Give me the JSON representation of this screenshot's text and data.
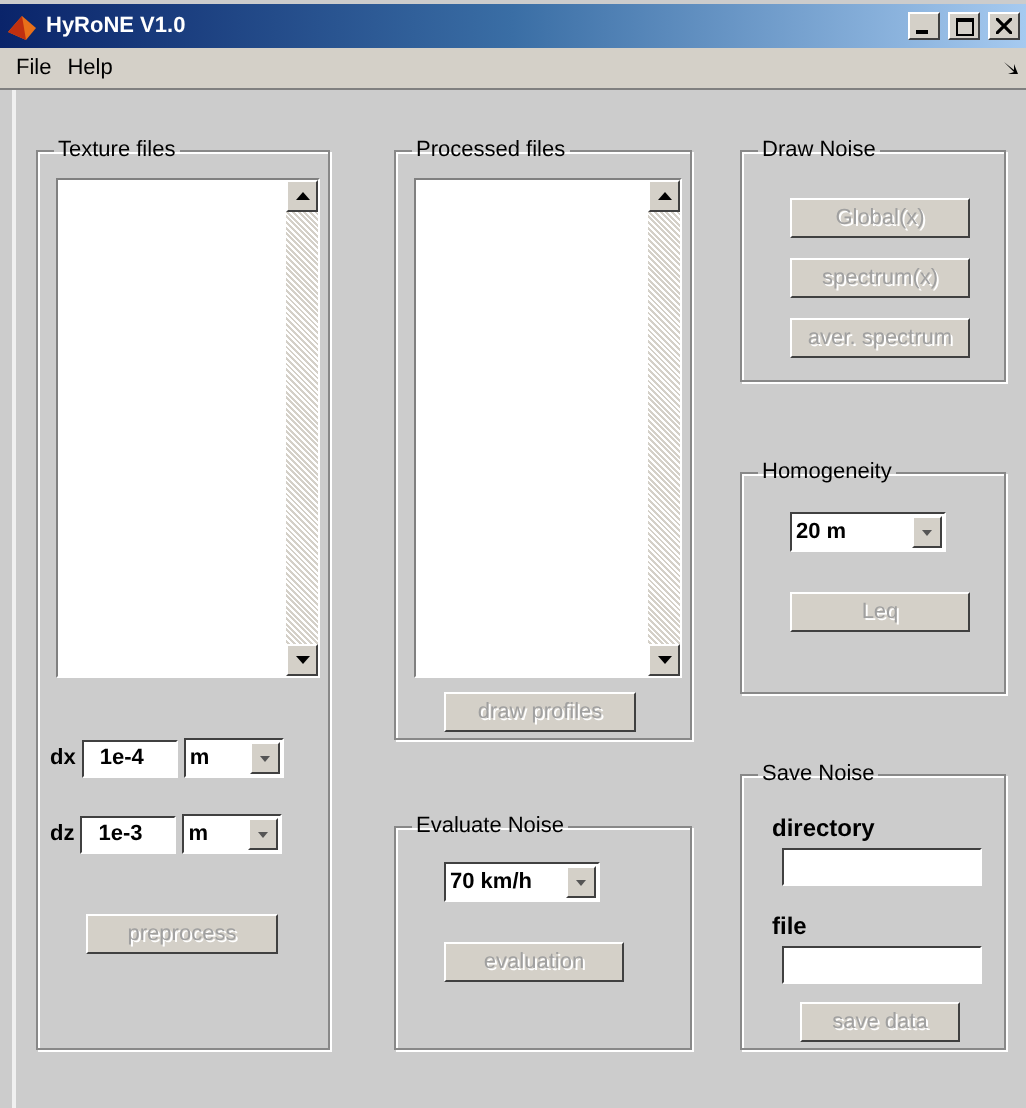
{
  "window": {
    "title": "HyRoNE V1.0"
  },
  "menu": [
    {
      "label": "File"
    },
    {
      "label": "Help"
    }
  ],
  "texture_files": {
    "title": "Texture files",
    "dx": {
      "label": "dx",
      "value": "1e-4",
      "unit": "m"
    },
    "dz": {
      "label": "dz",
      "value": "1e-3",
      "unit": "m"
    },
    "button": {
      "label": "preprocess",
      "disabled": true
    }
  },
  "processed_files": {
    "title": "Processed files",
    "button": {
      "label": "draw profiles",
      "disabled": true
    }
  },
  "evaluate_noise": {
    "title": "Evaluate Noise",
    "speed": "70 km/h",
    "button": {
      "label": "evaluation",
      "disabled": true
    }
  },
  "draw_noise": {
    "title": "Draw Noise",
    "buttons": [
      {
        "label": "Global(x)",
        "disabled": true
      },
      {
        "label": "spectrum(x)",
        "disabled": true
      },
      {
        "label": "aver. spectrum",
        "disabled": true
      }
    ]
  },
  "homogeneity": {
    "title": "Homogeneity",
    "distance": "20 m",
    "button": {
      "label": "Leq",
      "disabled": true
    }
  },
  "save_noise": {
    "title": "Save Noise",
    "directory_label": "directory",
    "file_label": "file",
    "button": {
      "label": "save data",
      "disabled": true
    }
  }
}
